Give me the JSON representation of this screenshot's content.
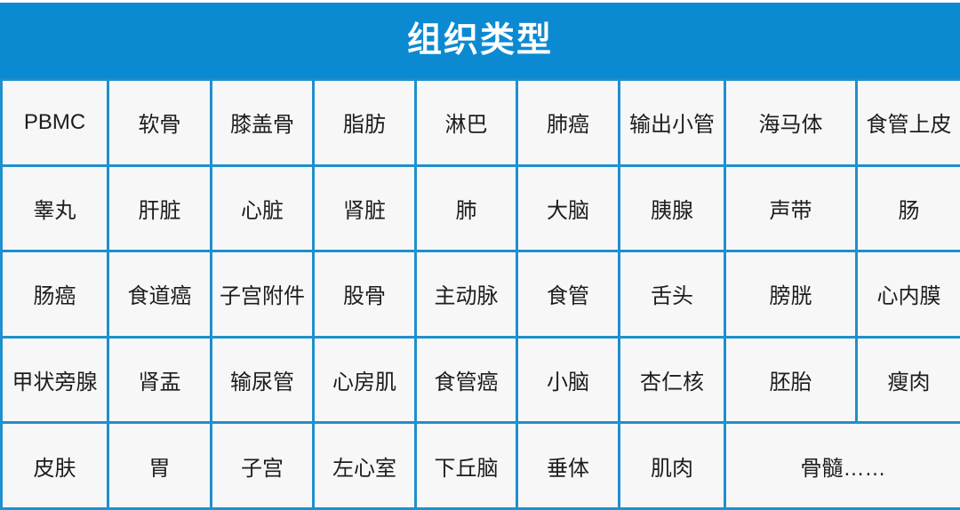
{
  "header": {
    "title": "组织类型",
    "background_color": "#0c8ad1",
    "text_color": "#ffffff"
  },
  "table": {
    "border_color": "#1e90cd",
    "cell_background": "#f7f7f8",
    "cell_text_color": "#1d1d1d",
    "columns": 9,
    "rows": [
      {
        "cells": [
          {
            "label": "PBMC",
            "colspan": 1
          },
          {
            "label": "软骨",
            "colspan": 1
          },
          {
            "label": "膝盖骨",
            "colspan": 1
          },
          {
            "label": "脂肪",
            "colspan": 1
          },
          {
            "label": "淋巴",
            "colspan": 1
          },
          {
            "label": "肺癌",
            "colspan": 1
          },
          {
            "label": "输出小管",
            "colspan": 1
          },
          {
            "label": "海马体",
            "colspan": 1
          },
          {
            "label": "食管上皮",
            "colspan": 1
          }
        ]
      },
      {
        "cells": [
          {
            "label": "睾丸",
            "colspan": 1
          },
          {
            "label": "肝脏",
            "colspan": 1
          },
          {
            "label": "心脏",
            "colspan": 1
          },
          {
            "label": "肾脏",
            "colspan": 1
          },
          {
            "label": "肺",
            "colspan": 1
          },
          {
            "label": "大脑",
            "colspan": 1
          },
          {
            "label": "胰腺",
            "colspan": 1
          },
          {
            "label": "声带",
            "colspan": 1
          },
          {
            "label": "肠",
            "colspan": 1
          }
        ]
      },
      {
        "cells": [
          {
            "label": "肠癌",
            "colspan": 1
          },
          {
            "label": "食道癌",
            "colspan": 1
          },
          {
            "label": "子宫附件",
            "colspan": 1
          },
          {
            "label": "股骨",
            "colspan": 1
          },
          {
            "label": "主动脉",
            "colspan": 1
          },
          {
            "label": "食管",
            "colspan": 1
          },
          {
            "label": "舌头",
            "colspan": 1
          },
          {
            "label": "膀胱",
            "colspan": 1
          },
          {
            "label": "心内膜",
            "colspan": 1
          }
        ]
      },
      {
        "cells": [
          {
            "label": "甲状旁腺",
            "colspan": 1
          },
          {
            "label": "肾盂",
            "colspan": 1
          },
          {
            "label": "输尿管",
            "colspan": 1
          },
          {
            "label": "心房肌",
            "colspan": 1
          },
          {
            "label": "食管癌",
            "colspan": 1
          },
          {
            "label": "小脑",
            "colspan": 1
          },
          {
            "label": "杏仁核",
            "colspan": 1
          },
          {
            "label": "胚胎",
            "colspan": 1
          },
          {
            "label": "瘦肉",
            "colspan": 1
          }
        ]
      },
      {
        "cells": [
          {
            "label": "皮肤",
            "colspan": 1
          },
          {
            "label": "胃",
            "colspan": 1
          },
          {
            "label": "子宫",
            "colspan": 1
          },
          {
            "label": "左心室",
            "colspan": 1
          },
          {
            "label": "下丘脑",
            "colspan": 1
          },
          {
            "label": "垂体",
            "colspan": 1
          },
          {
            "label": "肌肉",
            "colspan": 1
          },
          {
            "label": "骨髓……",
            "colspan": 2
          }
        ]
      }
    ]
  }
}
